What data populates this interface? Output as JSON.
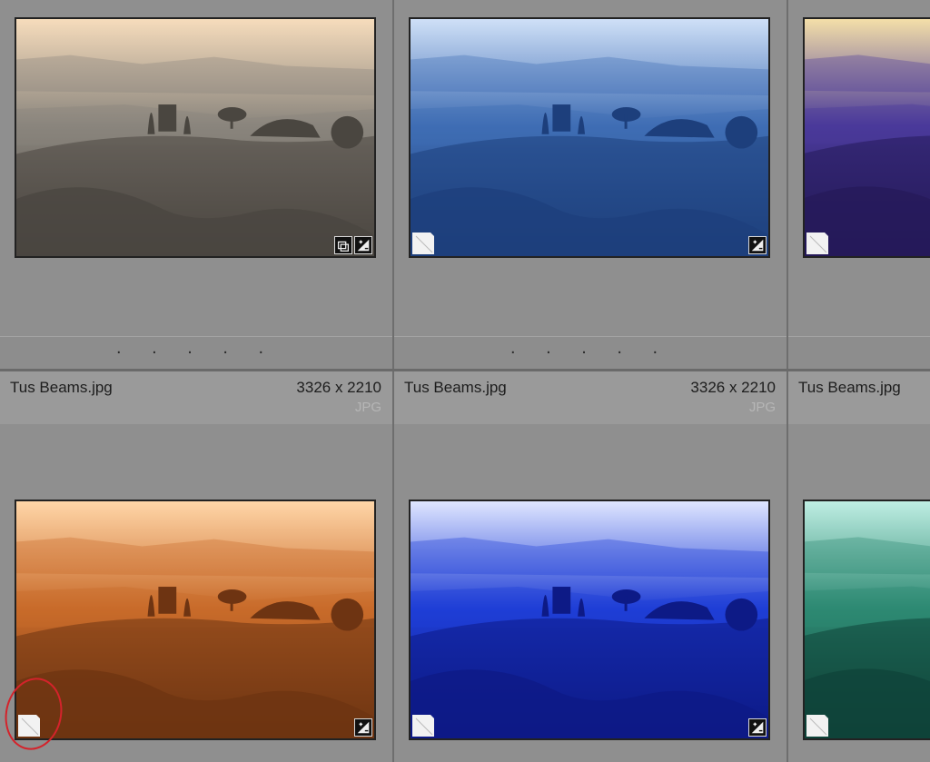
{
  "grid": {
    "cells": [
      {
        "filename": "Tus Beams.jpg",
        "dimensions": "3326 x 2210",
        "extension": "JPG"
      },
      {
        "filename": "Tus Beams.jpg",
        "dimensions": "3326 x 2210",
        "extension": "JPG"
      },
      {
        "filename": "Tus Beams.jpg",
        "dimensions": "",
        "extension": ""
      }
    ],
    "rating_dots": ". . . . ."
  },
  "thumbnails": [
    {
      "variant": "neutral",
      "sky": "#f6dcbc",
      "mid": "#8a857d",
      "dark": "#4a4640",
      "badges": [
        "virtual-copy-icon",
        "develop-adjust-icon"
      ]
    },
    {
      "variant": "blue",
      "sky": "#cfe0f7",
      "mid": "#3f6db4",
      "dark": "#1d3f7c",
      "badges": [
        "develop-adjust-icon"
      ],
      "page_corner": true
    },
    {
      "variant": "purple",
      "sky": "#f4dfa8",
      "mid": "#4a3a9a",
      "dark": "#251a59",
      "badges": [],
      "page_corner": true
    },
    {
      "variant": "orange",
      "sky": "#ffd6a8",
      "mid": "#c96b2a",
      "dark": "#6e3412",
      "badges": [
        "develop-adjust-icon"
      ],
      "page_corner": true,
      "highlighted": true
    },
    {
      "variant": "deep-blue",
      "sky": "#dfe6ff",
      "mid": "#1f3ed6",
      "dark": "#0d1a86",
      "badges": [
        "develop-adjust-icon"
      ],
      "page_corner": true
    },
    {
      "variant": "teal",
      "sky": "#bfeee3",
      "mid": "#2e8a73",
      "dark": "#0f4339",
      "badges": [],
      "page_corner": true
    }
  ]
}
